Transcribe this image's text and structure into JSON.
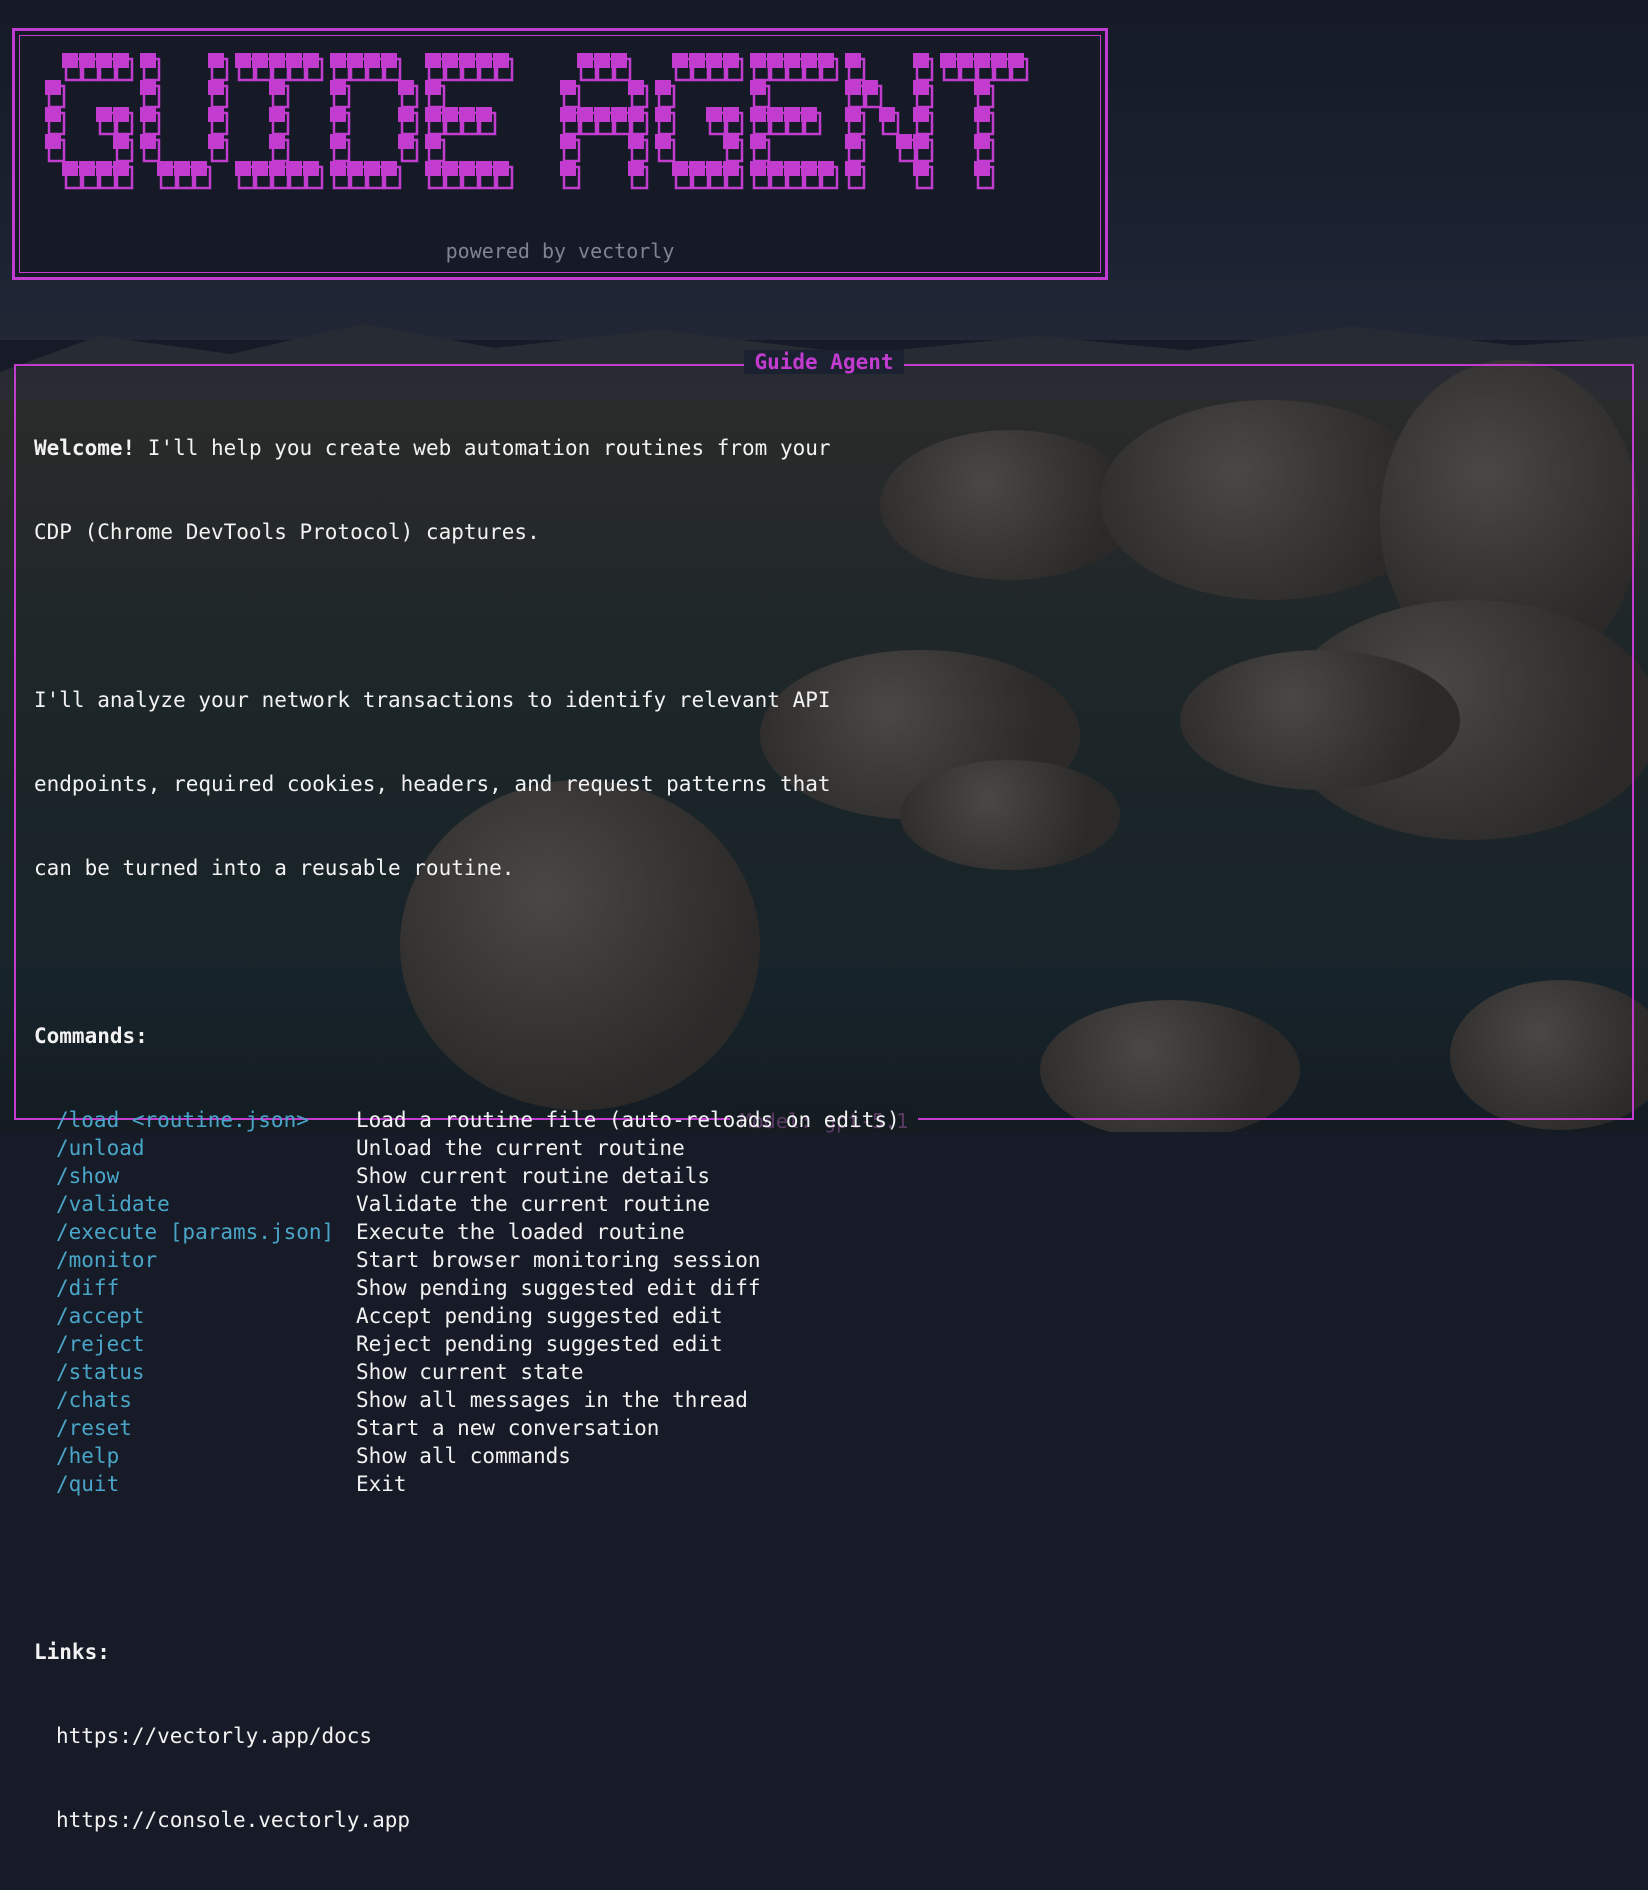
{
  "banner": {
    "logo_text": "GUIDE AGENT",
    "subtitle": "powered by vectorly",
    "color": "#c13ccf"
  },
  "panel": {
    "title": "Guide Agent",
    "footer": "Model: gpt-5.1",
    "intro": {
      "welcome": "Welcome!",
      "line1_rest": " I'll help you create web automation routines from your",
      "line2": "CDP (Chrome DevTools Protocol) captures.",
      "para2": [
        "I'll analyze your network transactions to identify relevant API",
        "endpoints, required cookies, headers, and request patterns that",
        "can be turned into a reusable routine."
      ]
    },
    "commands_heading": "Commands:",
    "commands": [
      {
        "name": "/load <routine.json>",
        "desc": "Load a routine file (auto-reloads on edits)"
      },
      {
        "name": "/unload",
        "desc": "Unload the current routine"
      },
      {
        "name": "/show",
        "desc": "Show current routine details"
      },
      {
        "name": "/validate",
        "desc": "Validate the current routine"
      },
      {
        "name": "/execute [params.json]",
        "desc": "Execute the loaded routine"
      },
      {
        "name": "/monitor",
        "desc": "Start browser monitoring session"
      },
      {
        "name": "/diff",
        "desc": "Show pending suggested edit diff"
      },
      {
        "name": "/accept",
        "desc": "Accept pending suggested edit"
      },
      {
        "name": "/reject",
        "desc": "Reject pending suggested edit"
      },
      {
        "name": "/status",
        "desc": "Show current state"
      },
      {
        "name": "/chats",
        "desc": "Show all messages in the thread"
      },
      {
        "name": "/reset",
        "desc": "Start a new conversation"
      },
      {
        "name": "/help",
        "desc": "Show all commands"
      },
      {
        "name": "/quit",
        "desc": "Exit"
      }
    ],
    "links_heading": "Links:",
    "links": [
      "https://vectorly.app/docs",
      "https://console.vectorly.app"
    ]
  },
  "colors": {
    "accent": "#c13ccf",
    "command": "#4aa6c8",
    "text": "#f2f2f2",
    "muted": "#7f8590"
  }
}
